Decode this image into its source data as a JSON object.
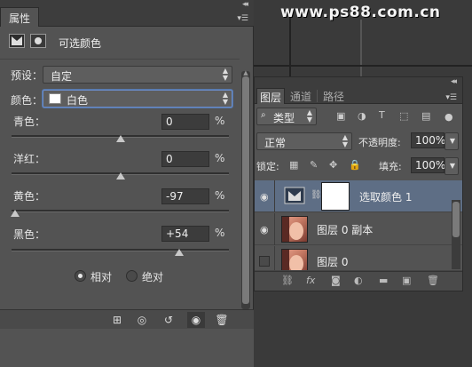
{
  "watermark": "www.ps88.com.cn",
  "properties": {
    "tab_label": "属性",
    "title": "可选颜色",
    "preset_label": "预设：",
    "preset_value": "自定",
    "colors_label": "颜色：",
    "colors_value": "白色",
    "sliders": [
      {
        "label": "青色：",
        "value": "0",
        "unit": "%",
        "level": 0.5
      },
      {
        "label": "洋红：",
        "value": "0",
        "unit": "%",
        "level": 0.5
      },
      {
        "label": "黄色：",
        "value": "-97",
        "unit": "%",
        "level": 0.015
      },
      {
        "label": "黑色：",
        "value": "+54",
        "unit": "%",
        "level": 0.77
      }
    ],
    "method_relative": "相对",
    "method_absolute": "绝对",
    "method_selected": "relative"
  },
  "layers": {
    "tabs": [
      "图层",
      "通道",
      "路径"
    ],
    "active_tab": "图层",
    "filter_kind": "类型",
    "blend_mode": "正常",
    "opacity_label": "不透明度:",
    "opacity_value": "100%",
    "lock_label": "锁定:",
    "fill_label": "填充:",
    "fill_value": "100%",
    "rows": [
      {
        "name": "选取颜色 1",
        "visible": true,
        "selected": true,
        "kind": "adjustment"
      },
      {
        "name": "图层 0 副本",
        "visible": true,
        "selected": false,
        "kind": "photo"
      },
      {
        "name": "图层 0",
        "visible": false,
        "selected": false,
        "kind": "photo"
      }
    ]
  },
  "colors": {
    "panel": "#535353",
    "selected_row": "#5e6e85",
    "focus": "#6a8cc8"
  }
}
